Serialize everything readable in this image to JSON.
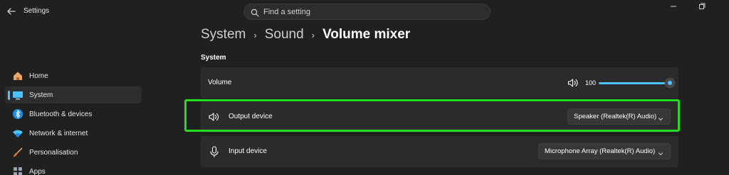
{
  "window": {
    "title": "Settings"
  },
  "search": {
    "placeholder": "Find a setting"
  },
  "sidebar": {
    "items": [
      {
        "label": "Home",
        "icon": "home-icon",
        "active": false
      },
      {
        "label": "System",
        "icon": "monitor-icon",
        "active": true
      },
      {
        "label": "Bluetooth & devices",
        "icon": "bluetooth-icon",
        "active": false
      },
      {
        "label": "Network & internet",
        "icon": "wifi-icon",
        "active": false
      },
      {
        "label": "Personalisation",
        "icon": "brush-icon",
        "active": false
      },
      {
        "label": "Apps",
        "icon": "apps-icon",
        "active": false
      }
    ]
  },
  "breadcrumb": {
    "items": [
      "System",
      "Sound"
    ],
    "current": "Volume mixer",
    "separator": "›"
  },
  "section": {
    "title": "System"
  },
  "volume": {
    "label": "Volume",
    "value": "100",
    "level_percent": 100
  },
  "output": {
    "label": "Output device",
    "selected": "Speaker (Realtek(R) Audio)"
  },
  "input": {
    "label": "Input device",
    "selected": "Microphone Array (Realtek(R) Audio)"
  },
  "colors": {
    "accent": "#4cc2ff",
    "highlight": "#22dd22",
    "background": "#202020",
    "card": "#2b2b2b"
  }
}
